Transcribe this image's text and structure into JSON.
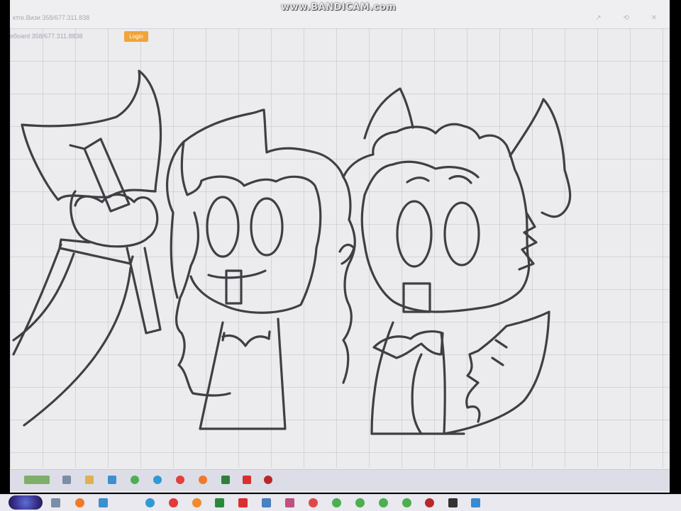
{
  "recording": {
    "watermark": "www.BANDICAM.com"
  },
  "whiteboard": {
    "title": "ктrе.Визи  358/677.311.838",
    "board_id": "ебoard 358/677.311.8838",
    "login_label": "Login",
    "window_icons": "↗ ⟲ ✕"
  },
  "inner_taskbar": {
    "icons": [
      {
        "name": "app-icon",
        "color": "#6a9a5a"
      },
      {
        "name": "file-icon",
        "color": "#7b8ea8"
      },
      {
        "name": "folder-icon",
        "color": "#e0b050"
      },
      {
        "name": "store-icon",
        "color": "#3d8fd0"
      },
      {
        "name": "chrome-icon",
        "color": "#4caf50"
      },
      {
        "name": "edge-icon",
        "color": "#2f9ad6"
      },
      {
        "name": "opera-icon",
        "color": "#e04040"
      },
      {
        "name": "firefox-icon",
        "color": "#f07a2a"
      },
      {
        "name": "app-icon",
        "color": "#2f7f3f"
      },
      {
        "name": "youtube-icon",
        "color": "#d83030"
      },
      {
        "name": "record-icon",
        "color": "#b82828"
      }
    ]
  },
  "outer_taskbar": {
    "icons": [
      {
        "name": "file-icon",
        "color": "#7b8ea8"
      },
      {
        "name": "firefox-icon",
        "color": "#f07a2a"
      },
      {
        "name": "store-icon",
        "color": "#3d8fd0"
      },
      {
        "name": "edge-icon",
        "color": "#2f9ad6"
      },
      {
        "name": "yandex-icon",
        "color": "#e03a3a"
      },
      {
        "name": "firefox-icon",
        "color": "#f08a2a"
      },
      {
        "name": "app-icon",
        "color": "#2a8a3a"
      },
      {
        "name": "youtube-icon",
        "color": "#d83030"
      },
      {
        "name": "notepad-icon",
        "color": "#4a7fc0"
      },
      {
        "name": "app-icon",
        "color": "#c05080"
      },
      {
        "name": "opera-icon",
        "color": "#e04848"
      },
      {
        "name": "chrome-icon",
        "color": "#4caf50"
      },
      {
        "name": "chrome-icon",
        "color": "#4caf50"
      },
      {
        "name": "chrome-icon",
        "color": "#4caf50"
      },
      {
        "name": "chrome-icon",
        "color": "#4caf50"
      },
      {
        "name": "record-icon",
        "color": "#b82828"
      },
      {
        "name": "app-icon",
        "color": "#333333"
      },
      {
        "name": "app-icon",
        "color": "#6a6a80"
      },
      {
        "name": "app-icon",
        "color": "#3a8ad0"
      }
    ]
  },
  "colors": {
    "canvas": "#ecebee",
    "stroke": "#3f3f44",
    "login": "#f0a43a"
  }
}
